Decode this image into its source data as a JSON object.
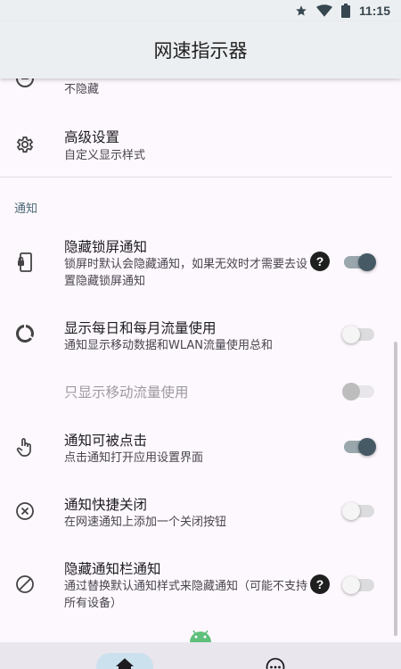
{
  "status_bar": {
    "time": "11:15",
    "icons": [
      "star-icon",
      "wifi-icon",
      "battery-icon"
    ]
  },
  "app_bar": {
    "title": "网速指示器"
  },
  "partial_item": {
    "subtitle": "不隐藏",
    "icon": "hide-icon"
  },
  "advanced": {
    "title": "高级设置",
    "subtitle": "自定义显示样式",
    "icon": "gear-icon"
  },
  "section": {
    "header": "通知"
  },
  "items": [
    {
      "title": "隐藏锁屏通知",
      "subtitle": "锁屏时默认会隐藏通知，如果无效时才需要去设置隐藏锁屏通知",
      "help": "?",
      "on": true,
      "enabled": true,
      "icon": "lock-screen-icon"
    },
    {
      "title": "显示每日和每月流量使用",
      "subtitle": "通知显示移动数据和WLAN流量使用总和",
      "on": false,
      "enabled": true,
      "icon": "data-usage-icon"
    },
    {
      "title": "只显示移动流量使用",
      "subtitle": "",
      "on": false,
      "enabled": false,
      "icon": ""
    },
    {
      "title": "通知可被点击",
      "subtitle": "点击通知打开应用设置界面",
      "on": true,
      "enabled": true,
      "icon": "touch-icon"
    },
    {
      "title": "通知快捷关闭",
      "subtitle": "在网速通知上添加一个关闭按钮",
      "on": false,
      "enabled": true,
      "icon": "close-circle-icon"
    },
    {
      "title": "隐藏通知栏通知",
      "subtitle": "通过替换默认通知样式来隐藏通知（可能不支持所有设备）",
      "help": "?",
      "on": false,
      "enabled": true,
      "icon": "block-icon"
    }
  ],
  "bottom_nav": {
    "items": [
      "home-icon",
      "more-icon"
    ]
  },
  "colors": {
    "accent": "#455a64",
    "app_bar": "#eceff1",
    "background": "#fdf8fd",
    "section_header": "#4d6a77"
  }
}
